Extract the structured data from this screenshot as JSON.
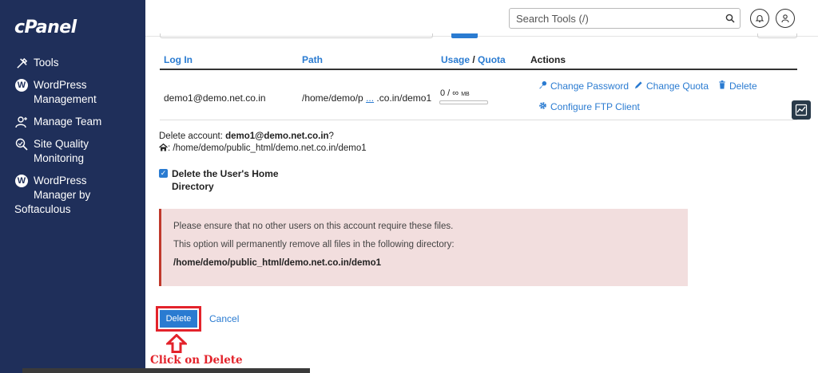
{
  "sidebar": {
    "logo": "cPanel",
    "items": [
      {
        "label": "Tools",
        "icon": "tools-icon"
      },
      {
        "label": "WordPress\nManagement",
        "icon": "wordpress-icon"
      },
      {
        "label": "Manage Team",
        "icon": "team-icon"
      },
      {
        "label": "Site Quality\nMonitoring",
        "icon": "site-quality-icon"
      },
      {
        "label": "WordPress\nManager by",
        "icon": "wordpress-icon"
      },
      {
        "label": "Softaculous"
      }
    ]
  },
  "header": {
    "search_placeholder": "Search Tools (/)"
  },
  "table": {
    "headers": {
      "login": "Log In",
      "path": "Path",
      "usage": "Usage",
      "sep": " / ",
      "quota": "Quota",
      "actions": "Actions"
    },
    "row": {
      "login": "demo1@demo.net.co.in",
      "path_start": "/home/demo/p",
      "path_ellipsis": "...",
      "path_end": ".co.in/demo1",
      "usage": "0 / ∞",
      "usage_unit": "MB",
      "usage_fraction": 0
    },
    "actions": {
      "change_password": "Change Password",
      "change_quota": "Change Quota",
      "delete": "Delete",
      "configure_ftp": "Configure FTP Client"
    }
  },
  "delete_section": {
    "prompt_prefix": "Delete account: ",
    "account": "demo1@demo.net.co.in",
    "prompt_suffix": "?",
    "home_path": ": /home/demo/public_html/demo.net.co.in/demo1",
    "checkbox_label": "Delete the User's Home Directory",
    "checkbox_checked": true
  },
  "alert": {
    "line1": "Please ensure that no other users on this account require these files.",
    "line2": "This option will permanently remove all files in the following directory:",
    "line3": "/home/demo/public_html/demo.net.co.in/demo1"
  },
  "buttons": {
    "delete": "Delete",
    "cancel": "Cancel"
  },
  "annotation": {
    "text": "Click on Delete",
    "color": "#e3232b"
  },
  "colors": {
    "sidebar_bg": "#1f2f5a",
    "link_blue": "#2a7bd1",
    "alert_bg": "#f2dede",
    "alert_border": "#c0392b"
  }
}
